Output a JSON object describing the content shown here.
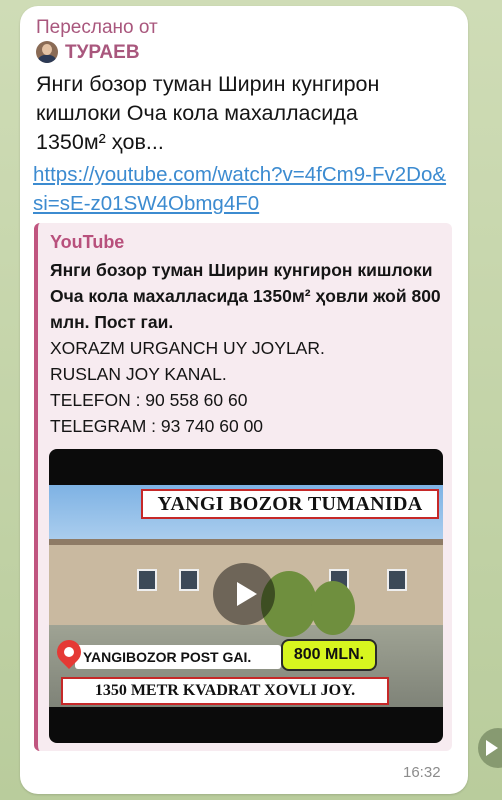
{
  "forward": {
    "label": "Переслано от",
    "sender": "ТУРАЕВ"
  },
  "message": {
    "text_line1": "Янги бозор туман Ширин кунгирон",
    "text_line2": "кишлоки Оча кола махалласида",
    "text_line3": "1350м²  ҳов...",
    "link": "https://youtube.com/watch?v=4fCm9-Fv2Do&si=sE-z01SW4Obmg4F0",
    "time": "16:32"
  },
  "preview": {
    "site": "YouTube",
    "title": "Янги бозор туман Ширин кунгирон кишлоки Оча кола махалласида 1350м²  ҳовли жой 800 млн. Пост гаи.",
    "desc_line1": "XORAZM URGANCH UY JOYLAR.",
    "desc_line2": "RUSLAN JOY KANAL.",
    "desc_line3": "TELEFON : 90 558 60 60",
    "desc_line4": "TELEGRAM : 93 740 60 00"
  },
  "thumbnail": {
    "banner_top": "YANGI BOZOR TUMANIDA",
    "location": "YANGIBOZOR POST GAI.",
    "price": "800 MLN.",
    "banner_bottom": "1350 METR KVADRAT XOVLI JOY."
  },
  "icons": {
    "play": "play-icon",
    "pin": "location-pin-icon",
    "share": "share-icon"
  },
  "colors": {
    "accent": "#a9577d",
    "link": "#3c8bd0",
    "preview_bg": "#f7ebf0"
  }
}
